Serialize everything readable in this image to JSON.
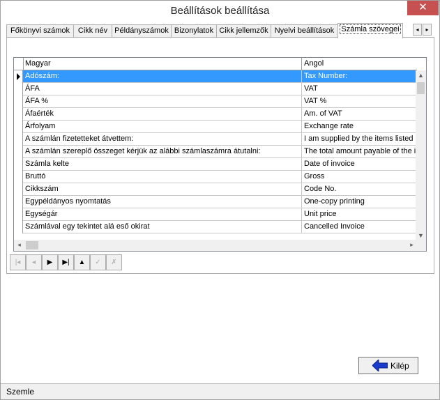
{
  "window": {
    "title": "Beállítások beállítása",
    "close_glyph": "✕"
  },
  "tabs": [
    {
      "label": "Főkönyvi számok"
    },
    {
      "label": "Cikk név"
    },
    {
      "label": "Példányszámok"
    },
    {
      "label": "Bizonylatok"
    },
    {
      "label": "Cikk jellemzők"
    },
    {
      "label": "Nyelvi beállítások"
    },
    {
      "label": "Számla szövegei"
    }
  ],
  "tab_scroll": {
    "left": "◂",
    "right": "▸"
  },
  "grid": {
    "columns": [
      "Magyar",
      "Angol"
    ],
    "rows": [
      {
        "magyar": "Adószám:",
        "angol": "Tax Number:",
        "selected": true
      },
      {
        "magyar": "ÁFA",
        "angol": "VAT"
      },
      {
        "magyar": "ÁFA %",
        "angol": "VAT %"
      },
      {
        "magyar": "Áfaérték",
        "angol": "Am. of VAT"
      },
      {
        "magyar": "Árfolyam",
        "angol": "Exchange rate"
      },
      {
        "magyar": "A számlán fizetetteket átvettem:",
        "angol": "I am supplied by the items listed on"
      },
      {
        "magyar": "A számlán szereplő összeget kérjük az alábbi számlaszámra átutalni:",
        "angol": "The total amount payable of the in"
      },
      {
        "magyar": "Számla kelte",
        "angol": "Date of invoice"
      },
      {
        "magyar": "Bruttó",
        "angol": "Gross"
      },
      {
        "magyar": "Cikkszám",
        "angol": "Code No."
      },
      {
        "magyar": "Egypéldányos nyomtatás",
        "angol": "One-copy printing"
      },
      {
        "magyar": "Egységár",
        "angol": "Unit price"
      },
      {
        "magyar": "Számlával egy tekintet alá eső okirat",
        "angol": "Cancelled Invoice"
      }
    ]
  },
  "navigator": [
    {
      "name": "nav-first-button",
      "glyph": "|◂",
      "enabled": false
    },
    {
      "name": "nav-prior-button",
      "glyph": "◂",
      "enabled": false
    },
    {
      "name": "nav-next-button",
      "glyph": "▶",
      "enabled": true
    },
    {
      "name": "nav-last-button",
      "glyph": "▶|",
      "enabled": true
    },
    {
      "name": "nav-insert-button",
      "glyph": "▲",
      "enabled": true
    },
    {
      "name": "nav-post-button",
      "glyph": "✓",
      "enabled": false
    },
    {
      "name": "nav-cancel-button",
      "glyph": "✗",
      "enabled": false
    }
  ],
  "exit_button": {
    "label": "Kilép",
    "arrow_color": "#1a3ccc"
  },
  "status": {
    "text": "Szemle"
  }
}
